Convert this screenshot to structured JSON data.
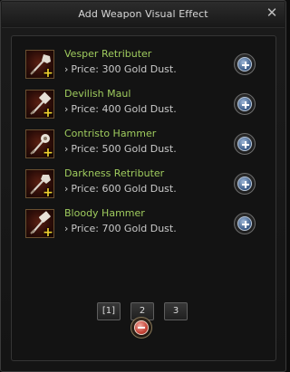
{
  "window": {
    "title": "Add Weapon Visual Effect"
  },
  "close_glyph": "✕",
  "price_prefix": "›",
  "items": [
    {
      "name": "Vesper Retributer",
      "price": "Price: 300 Gold Dust.",
      "icon": "mace-icon"
    },
    {
      "name": "Devilish Maul",
      "price": "Price: 400 Gold Dust.",
      "icon": "maul-icon"
    },
    {
      "name": "Contristo Hammer",
      "price": "Price: 500 Gold Dust.",
      "icon": "hammer-icon"
    },
    {
      "name": "Darkness Retributer",
      "price": "Price: 600 Gold Dust.",
      "icon": "mace-icon"
    },
    {
      "name": "Bloody Hammer",
      "price": "Price: 700 Gold Dust.",
      "icon": "hammer-icon"
    }
  ],
  "badge_glyph": "+",
  "pagination": {
    "pages": [
      "[1]",
      "2",
      "3"
    ],
    "current": "[1]"
  },
  "colors": {
    "item_name": "#9fcc5e",
    "add_button": "#3a5a86",
    "remove_button": "#c64538"
  }
}
